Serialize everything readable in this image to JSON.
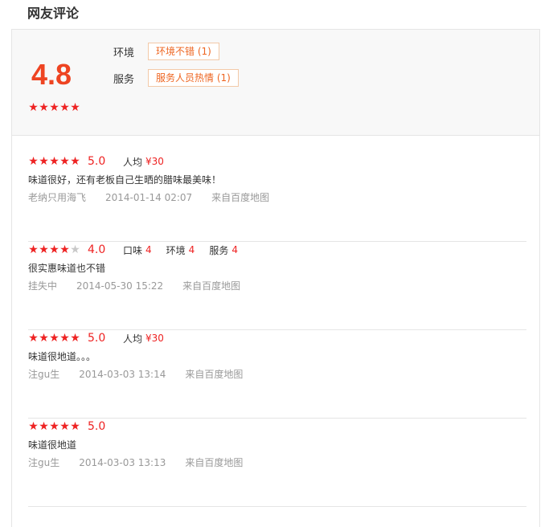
{
  "section_title": "网友评论",
  "summary": {
    "score": "4.8",
    "stars": 5,
    "tags": [
      {
        "label": "环境",
        "tag": "环境不错 (1)"
      },
      {
        "label": "服务",
        "tag": "服务人员热情 (1)"
      }
    ]
  },
  "star_glyph": "★",
  "colors": {
    "accent": "#ee2222",
    "score": "#ee4422",
    "tag_text": "#ee6622",
    "muted": "#999999"
  },
  "reviews": [
    {
      "stars": 5,
      "score": "5.0",
      "meta": [
        {
          "label": "人均",
          "value": "¥30"
        }
      ],
      "text": "味道很好，还有老板自己生晒的腊味最美味！",
      "user": "老纳只用海飞",
      "time": "2014-01-14 02:07",
      "source": "来自百度地图"
    },
    {
      "stars": 4,
      "score": "4.0",
      "meta": [
        {
          "label": "口味",
          "value": "4"
        },
        {
          "label": "环境",
          "value": "4"
        },
        {
          "label": "服务",
          "value": "4"
        }
      ],
      "text": "很实惠味道也不错",
      "user": "挂失中",
      "time": "2014-05-30 15:22",
      "source": "来自百度地图"
    },
    {
      "stars": 5,
      "score": "5.0",
      "meta": [
        {
          "label": "人均",
          "value": "¥30"
        }
      ],
      "text": "味道很地道。。。",
      "user": "注gu生",
      "time": "2014-03-03 13:14",
      "source": "来自百度地图"
    },
    {
      "stars": 5,
      "score": "5.0",
      "meta": [],
      "text": "味道很地道",
      "user": "注gu生",
      "time": "2014-03-03 13:13",
      "source": "来自百度地图"
    }
  ]
}
